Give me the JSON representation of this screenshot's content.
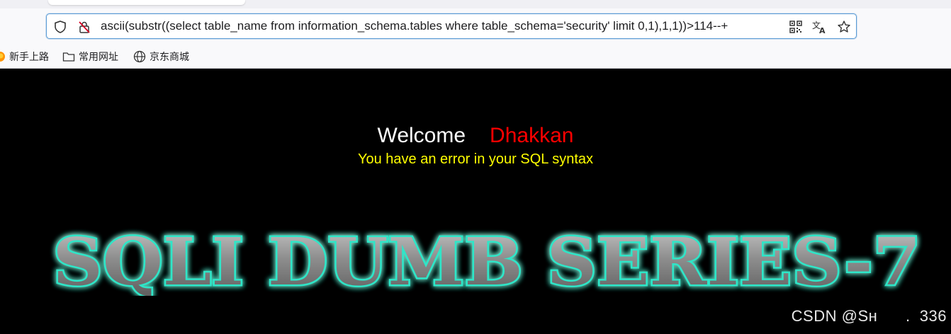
{
  "browser": {
    "url": "ascii(substr((select table_name from information_schema.tables where table_schema='security' limit 0,1),1,1))>114--+",
    "bookmarks": [
      {
        "label": "新手上路",
        "icon": "firefox-icon"
      },
      {
        "label": "常用网址",
        "icon": "folder-icon"
      },
      {
        "label": "京东商城",
        "icon": "globe-icon"
      }
    ],
    "icons": {
      "shield": "shield-icon",
      "insecure": "insecure-lock-icon",
      "qr": "qr-code-icon",
      "translate": "translate-icon",
      "star": "bookmark-star-icon"
    }
  },
  "page": {
    "welcome": "Welcome",
    "name": "Dhakkan",
    "message": "You have an error in your SQL syntax",
    "banner": "SQLI DUMB SERIES-7",
    "colors": {
      "background": "#000000",
      "welcome": "#ffffff",
      "name": "#ff0000",
      "message": "#ffff00",
      "banner_glow": "#2ee6c8"
    }
  },
  "watermark": "CSDN @Sн      .  336"
}
